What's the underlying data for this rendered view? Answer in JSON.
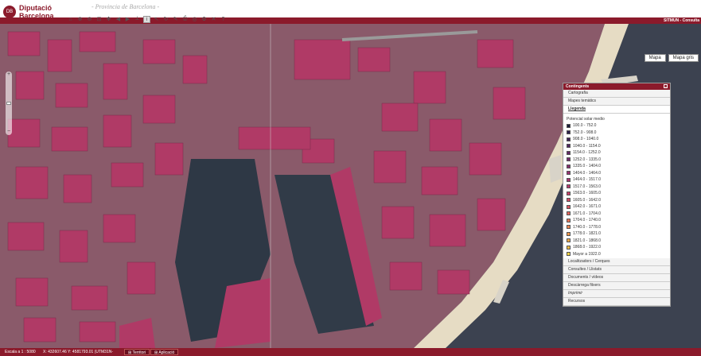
{
  "header": {
    "logo_mark": "DB",
    "logo_line1": "Diputació",
    "logo_line2": "Barcelona",
    "site_title": "- Provincia de Barcelona -",
    "app_label": "SITMUN - Consulta"
  },
  "toolbar": {
    "tools": [
      {
        "name": "home-icon",
        "glyph": "⌂"
      },
      {
        "name": "zoom-in-icon",
        "glyph": "⊕"
      },
      {
        "name": "zoom-out-icon",
        "glyph": "⊖"
      },
      {
        "name": "zoom-extent-icon",
        "glyph": "⊡"
      },
      {
        "name": "pan-icon",
        "glyph": "✥"
      },
      {
        "name": "previous-view-icon",
        "glyph": "◀"
      },
      {
        "name": "next-view-icon",
        "glyph": "▶"
      },
      {
        "name": "measure-icon",
        "glyph": "⟂"
      },
      {
        "name": "info-icon",
        "glyph": "i"
      },
      {
        "name": "select-icon",
        "glyph": "↖"
      },
      {
        "name": "refresh-icon",
        "glyph": "↻"
      },
      {
        "name": "draw-icon",
        "glyph": "✎"
      },
      {
        "name": "print-icon",
        "glyph": "⎙"
      },
      {
        "name": "globe-icon",
        "glyph": "◎"
      },
      {
        "name": "settings-icon",
        "glyph": "⚙"
      },
      {
        "name": "clear-icon",
        "glyph": "✕"
      },
      {
        "name": "help-icon",
        "glyph": "?"
      }
    ]
  },
  "map_buttons": {
    "map": "Mapa",
    "map_gray": "Mapa gris"
  },
  "zoom": {
    "plus": "+",
    "minus": "−"
  },
  "panel": {
    "title": "Contingents",
    "sections_top": [
      "Cartografia",
      "Mapes temàtics",
      "Llegenda"
    ],
    "legend_title": "Potencial solar medio",
    "legend": [
      {
        "label": "100.0 - 752.0",
        "color": "#1b1d3a"
      },
      {
        "label": "752.0 - 908.0",
        "color": "#2a1f4a"
      },
      {
        "label": "908.0 - 1040.0",
        "color": "#3c2255"
      },
      {
        "label": "1040.0 - 1154.0",
        "color": "#50255e"
      },
      {
        "label": "1154.0 - 1252.0",
        "color": "#622865"
      },
      {
        "label": "1252.0 - 1335.0",
        "color": "#742b6b"
      },
      {
        "label": "1335.0 - 1404.0",
        "color": "#872e6e"
      },
      {
        "label": "1404.0 - 1464.0",
        "color": "#98316f"
      },
      {
        "label": "1464.0 - 1517.0",
        "color": "#a8346f"
      },
      {
        "label": "1517.0 - 1563.0",
        "color": "#b8396d"
      },
      {
        "label": "1563.0 - 1605.0",
        "color": "#c6406a"
      },
      {
        "label": "1605.0 - 1642.0",
        "color": "#d14a66"
      },
      {
        "label": "1642.0 - 1671.0",
        "color": "#da5662"
      },
      {
        "label": "1671.0 - 1704.0",
        "color": "#e1645d"
      },
      {
        "label": "1704.0 - 1740.0",
        "color": "#e67357"
      },
      {
        "label": "1740.0 - 1778.0",
        "color": "#ea8452"
      },
      {
        "label": "1778.0 - 1821.0",
        "color": "#ed954c"
      },
      {
        "label": "1821.0 - 1868.0",
        "color": "#efa747"
      },
      {
        "label": "1868.0 - 1922.0",
        "color": "#efba42"
      },
      {
        "label": "Mayor a 1922.0",
        "color": "#eed044"
      }
    ],
    "sections_bottom": [
      {
        "label": "Localitzadors / Cerques",
        "italic": false
      },
      {
        "label": "Consultes / Llistats",
        "italic": false
      },
      {
        "label": "Documents / vídeos",
        "italic": false
      },
      {
        "label": "Descàrrega fitxers",
        "italic": false
      },
      {
        "label": "Imprimir",
        "italic": true
      },
      {
        "label": "Recursos",
        "italic": false
      }
    ]
  },
  "status": {
    "scale": "Escala a 1 : 5080",
    "coords": "X: 432607.46 Y: 4581793.01 (UTM31N-",
    "btn_territory": "Territori",
    "btn_application": "Aplicació"
  },
  "colors": {
    "brand": "#8b1a2b",
    "sea": "#3c4250",
    "roof": "#b03a66",
    "beach": "#e6dcc4"
  }
}
